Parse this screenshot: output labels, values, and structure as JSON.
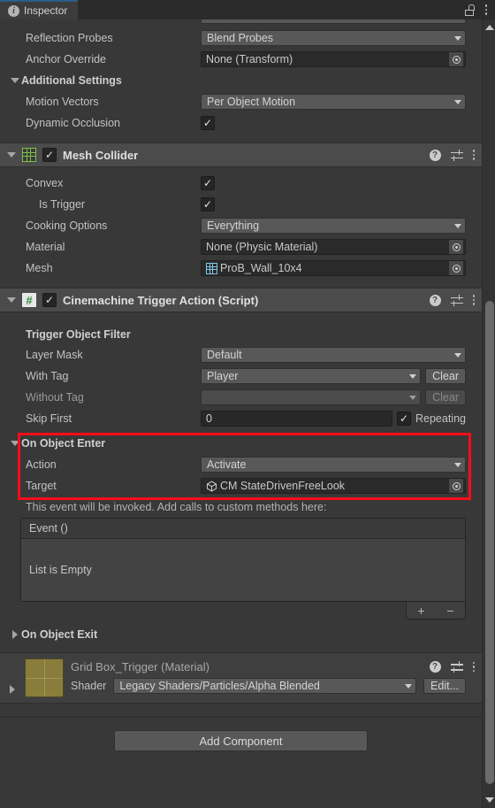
{
  "window": {
    "tab_label": "Inspector",
    "info_glyph": "i",
    "lock_icon": "lock-icon",
    "menu_icon": "kebab-menu-icon"
  },
  "renderer_tail": {
    "rows": [
      {
        "label": "Reflection Probes",
        "type": "dropdown",
        "value": "Blend Probes"
      },
      {
        "label": "Anchor Override",
        "type": "object",
        "value": "None (Transform)"
      }
    ],
    "additional_settings": {
      "label": "Additional Settings",
      "expanded": true,
      "rows": [
        {
          "label": "Motion Vectors",
          "type": "dropdown",
          "value": "Per Object Motion"
        },
        {
          "label": "Dynamic Occlusion",
          "type": "checkbox",
          "value": true
        }
      ]
    }
  },
  "mesh_collider": {
    "title": "Mesh Collider",
    "icon": "mesh-grid-icon",
    "enabled": true,
    "expanded": true,
    "help_icon": "help-icon",
    "preset_icon": "preset-settings-icon",
    "menu_icon": "kebab-menu-icon",
    "rows": [
      {
        "label": "Convex",
        "type": "checkbox",
        "value": true
      },
      {
        "label": "Is Trigger",
        "type": "checkbox",
        "value": true,
        "indent": 2
      },
      {
        "label": "Cooking Options",
        "type": "dropdown",
        "value": "Everything"
      },
      {
        "label": "Material",
        "type": "object",
        "value": "None (Physic Material)"
      },
      {
        "label": "Mesh",
        "type": "object",
        "value": "ProB_Wall_10x4",
        "icon": "mesh-asset-icon"
      }
    ]
  },
  "cinemachine_trigger": {
    "title": "Cinemachine Trigger Action (Script)",
    "icon": "script-icon",
    "icon_glyph": "#",
    "enabled": true,
    "expanded": true,
    "help_icon": "help-icon",
    "preset_icon": "preset-settings-icon",
    "menu_icon": "kebab-menu-icon",
    "filter_header": "Trigger Object Filter",
    "rows": [
      {
        "label": "Layer Mask",
        "type": "dropdown",
        "value": "Default"
      },
      {
        "label": "With Tag",
        "type": "dropdown",
        "value": "Player",
        "button": "Clear",
        "button_disabled": false
      },
      {
        "label": "Without Tag",
        "type": "dropdown",
        "value": "",
        "button": "Clear",
        "button_disabled": true,
        "disabled": true
      },
      {
        "label": "Skip First",
        "type": "number",
        "value": "0",
        "suffix_checkbox": true,
        "suffix_label": "Repeating",
        "suffix_value": true
      }
    ],
    "on_object_enter": {
      "title": "On Object Enter",
      "expanded": true,
      "highlighted": true,
      "highlight_color": "#fd0d1b",
      "action": {
        "label": "Action",
        "value": "Activate"
      },
      "target": {
        "label": "Target",
        "value": "CM StateDrivenFreeLook",
        "icon": "gameobject-cube-icon"
      },
      "event_hint": "This event will be invoked.  Add calls to custom methods here:",
      "event_header": "Event ()",
      "event_empty": "List is Empty",
      "add_button": "+",
      "remove_button": "−"
    },
    "on_object_exit": {
      "title": "On Object Exit",
      "expanded": false
    }
  },
  "material_block": {
    "title": "Grid Box_Trigger (Material)",
    "expanded": false,
    "thumbnail_color": "#8a7d3c",
    "help_icon": "help-icon",
    "preset_icon": "preset-settings-icon",
    "menu_icon": "kebab-menu-icon",
    "shader_label": "Shader",
    "shader_value": "Legacy Shaders/Particles/Alpha Blended",
    "edit_button": "Edit..."
  },
  "footer": {
    "add_component": "Add Component"
  },
  "scrollbar": {
    "up_arrow": "scroll-up-arrow",
    "down_arrow": "scroll-down-arrow"
  },
  "checkmark": "✓"
}
